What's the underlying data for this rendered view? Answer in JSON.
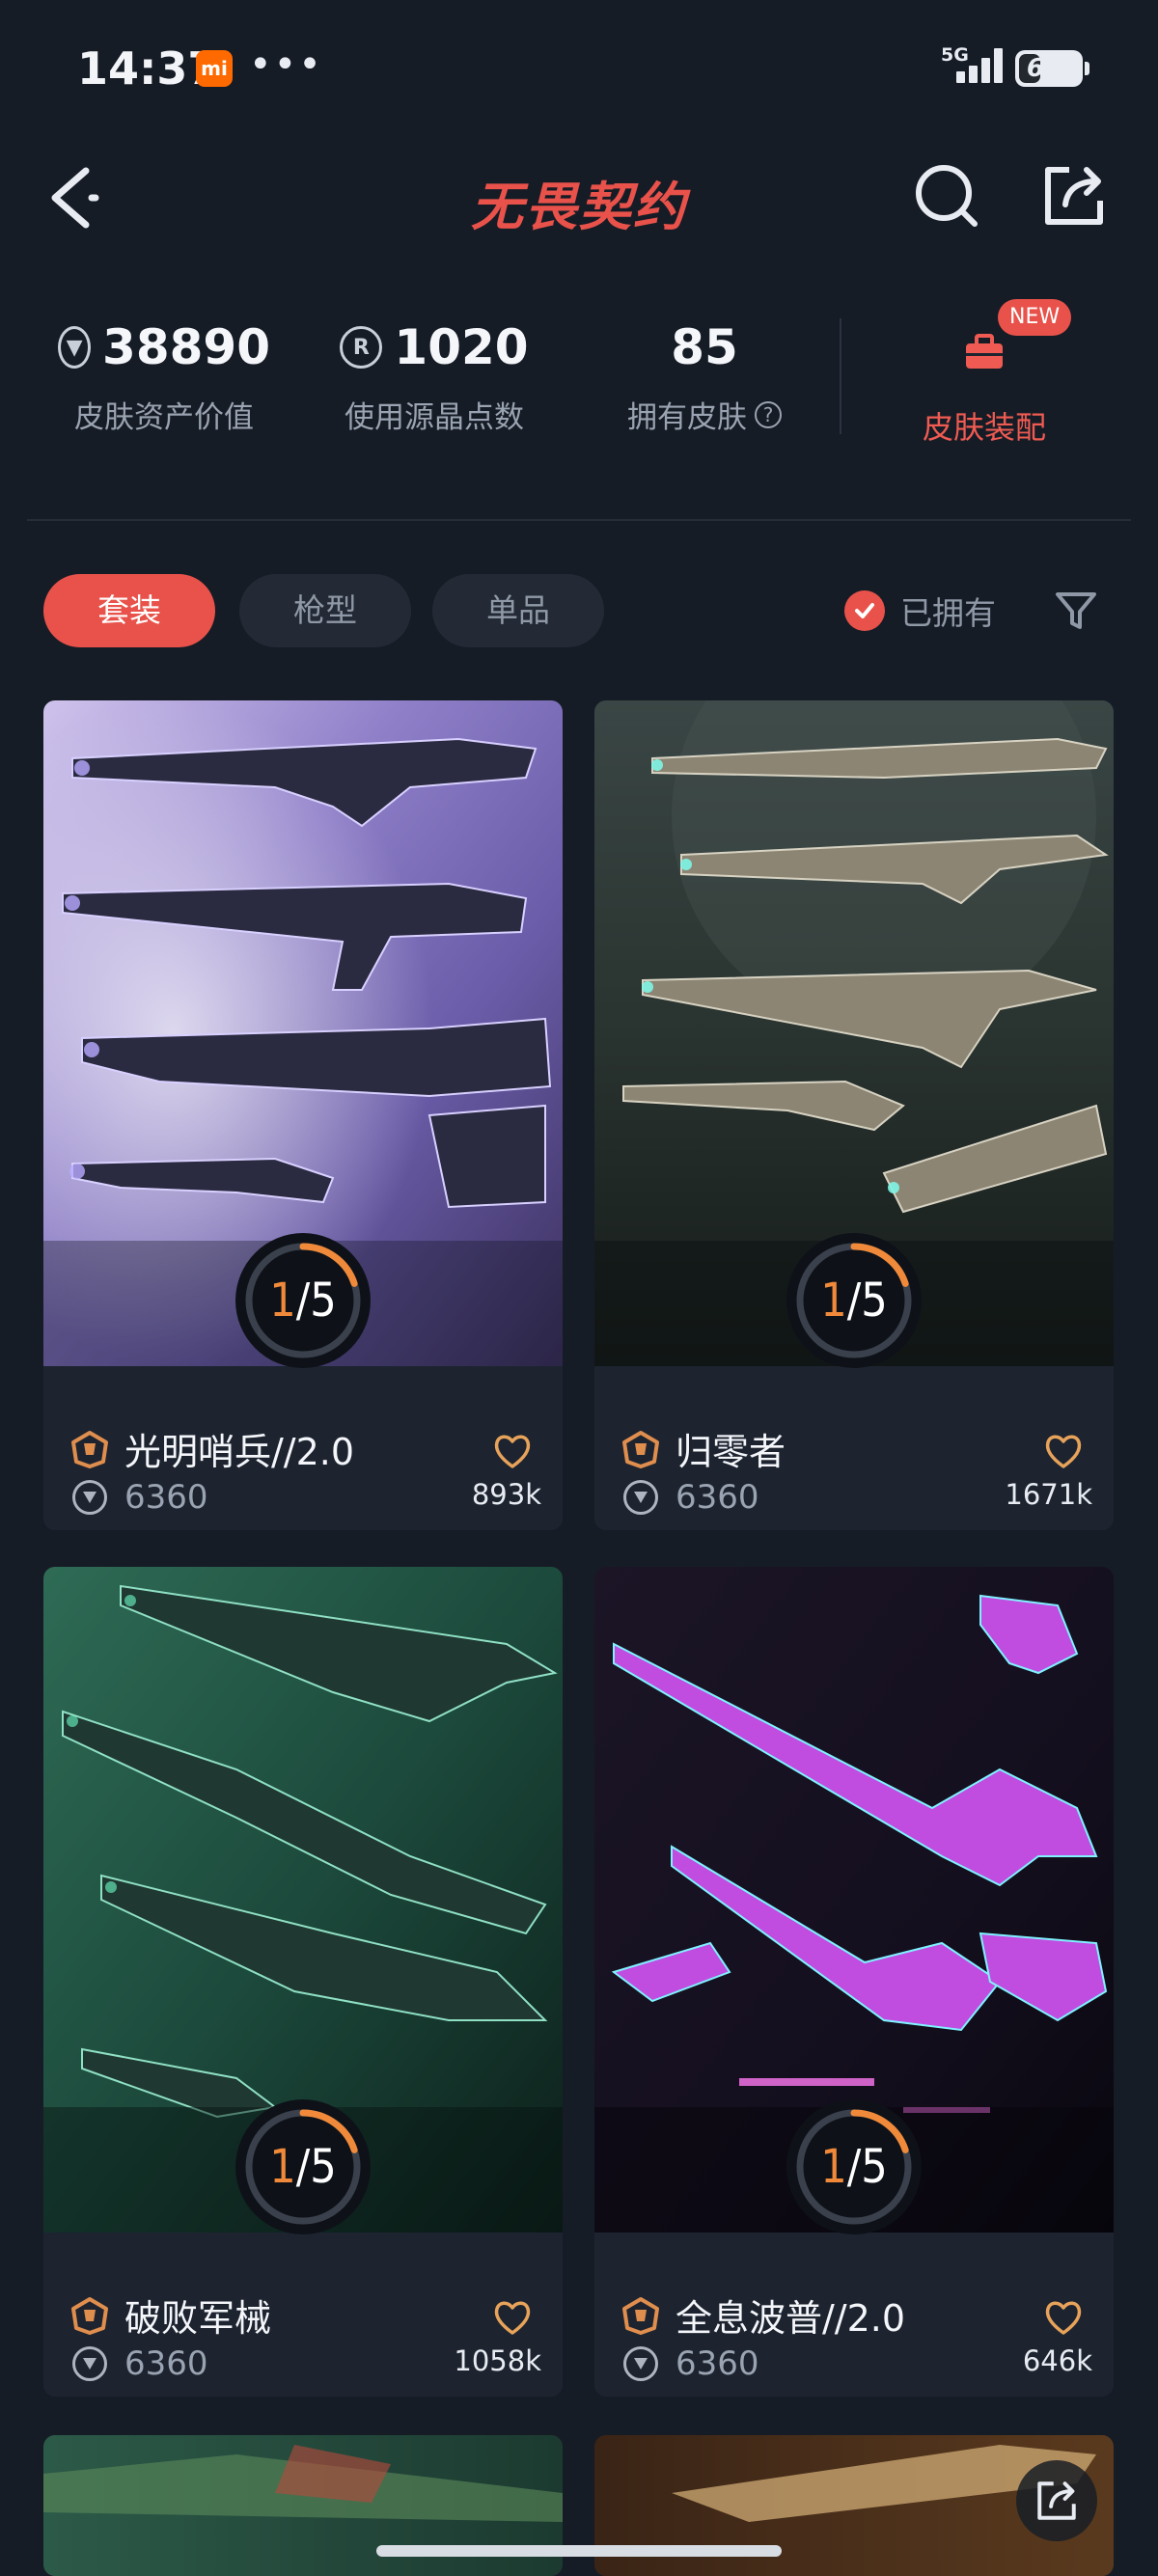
{
  "status_bar": {
    "time": "14:37",
    "mi_badge": "mi",
    "dots": "•••",
    "network": "5G",
    "battery": "67"
  },
  "header": {
    "title": "无畏契约",
    "back_icon": "chevron-left-icon",
    "search_icon": "search-icon",
    "share_icon": "share-icon"
  },
  "stats": [
    {
      "value": "38890",
      "label": "皮肤资产价值",
      "icon": "vp-coin-icon"
    },
    {
      "value": "1020",
      "label": "使用源晶点数",
      "icon": "radianite-icon"
    },
    {
      "value": "85",
      "label": "拥有皮肤",
      "icon": "help-icon"
    }
  ],
  "equip": {
    "label": "皮肤装配",
    "badge": "NEW"
  },
  "filters": {
    "tabs": [
      "套装",
      "枪型",
      "单品"
    ],
    "active_tab": "套装",
    "owned_label": "已拥有",
    "owned_checked": true
  },
  "colors": {
    "accent": "#e8524a",
    "background": "#161c26",
    "card": "#1d2430",
    "progress": "#f08a3a"
  },
  "cards": [
    {
      "name": "光明哨兵//2.0",
      "owned": "1",
      "total": "/5",
      "price": "6360",
      "count": "893k",
      "theme": "purple"
    },
    {
      "name": "归零者",
      "owned": "1",
      "total": "/5",
      "price": "6360",
      "count": "1671k",
      "theme": "gray"
    },
    {
      "name": "破败军械",
      "owned": "1",
      "total": "/5",
      "price": "6360",
      "count": "1058k",
      "theme": "green"
    },
    {
      "name": "全息波普//2.0",
      "owned": "1",
      "total": "/5",
      "price": "6360",
      "count": "646k",
      "theme": "neon"
    }
  ]
}
